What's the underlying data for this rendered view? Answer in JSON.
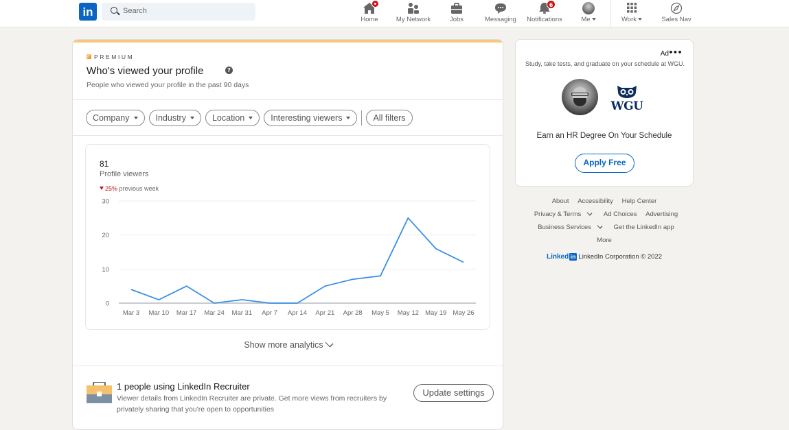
{
  "topbar": {
    "logo": "in",
    "search_placeholder": "Search",
    "nav": [
      {
        "id": "home",
        "label": "Home",
        "icon": "home-icon",
        "badge_dot": true
      },
      {
        "id": "my-network",
        "label": "My Network",
        "icon": "people-icon"
      },
      {
        "id": "jobs",
        "label": "Jobs",
        "icon": "briefcase-icon"
      },
      {
        "id": "messaging",
        "label": "Messaging",
        "icon": "chat-icon"
      },
      {
        "id": "notifications",
        "label": "Notifications",
        "icon": "bell-icon",
        "badge": "6"
      },
      {
        "id": "me",
        "label": "Me",
        "icon": "avatar-icon",
        "dropdown": true
      },
      {
        "id": "work",
        "label": "Work",
        "icon": "grid-icon",
        "dropdown": true
      },
      {
        "id": "sales-nav",
        "label": "Sales Nav",
        "icon": "compass-icon"
      }
    ]
  },
  "main": {
    "premium_label": "PREMIUM",
    "title": "Who's viewed your profile",
    "help_icon": "?",
    "subtitle": "People who viewed your profile in the past 90 days",
    "filters": [
      {
        "label": "Company",
        "dropdown": true
      },
      {
        "label": "Industry",
        "dropdown": true
      },
      {
        "label": "Location",
        "dropdown": true
      },
      {
        "label": "Interesting viewers",
        "dropdown": true
      }
    ],
    "all_filters_label": "All filters",
    "metric": {
      "value": "81",
      "label": "Profile viewers",
      "delta_pct": "25%",
      "delta_direction": "down",
      "delta_suffix": "previous week"
    },
    "show_more_label": "Show more analytics",
    "recruiter": {
      "title": "1 people using LinkedIn Recruiter",
      "description": "Viewer details from LinkedIn Recruiter are private. Get more views from recruiters by privately sharing that you're open to opportunities",
      "button_label": "Update settings"
    }
  },
  "chart_data": {
    "type": "line",
    "title": "",
    "xlabel": "",
    "ylabel": "",
    "categories": [
      "Mar 3",
      "Mar 10",
      "Mar 17",
      "Mar 24",
      "Mar 31",
      "Apr 7",
      "Apr 14",
      "Apr 21",
      "Apr 28",
      "May 5",
      "May 12",
      "May 19",
      "May 26"
    ],
    "series": [
      {
        "name": "Profile viewers",
        "values": [
          4,
          1,
          5,
          0,
          1,
          0,
          0,
          5,
          7,
          8,
          25,
          16,
          12
        ],
        "color": "#3a8ee6"
      }
    ],
    "yticks": [
      0,
      10,
      20,
      30
    ],
    "ylim": [
      0,
      30
    ],
    "grid": true,
    "legend": "none"
  },
  "ad": {
    "label": "Ad",
    "more_label": "•••",
    "text": "Study, take tests, and graduate on your schedule at WGU.",
    "brand": "WGU",
    "headline": "Earn an HR Degree On Your Schedule",
    "button_label": "Apply Free"
  },
  "footer": {
    "rows": [
      [
        {
          "label": "About"
        },
        {
          "label": "Accessibility"
        },
        {
          "label": "Help Center"
        }
      ],
      [
        {
          "label": "Privacy & Terms",
          "dropdown": true
        },
        {
          "label": "Ad Choices"
        },
        {
          "label": "Advertising"
        }
      ],
      [
        {
          "label": "Business Services",
          "dropdown": true
        },
        {
          "label": "Get the LinkedIn app"
        }
      ],
      [
        {
          "label": "More"
        }
      ]
    ],
    "brand_text": "Linked",
    "brand_box": "in",
    "copyright": "LinkedIn Corporation © 2022"
  },
  "colors": {
    "brand": "#0a66c2",
    "premium_accent": "#f8c77e",
    "alert_red": "#cc1016",
    "chart_line": "#3a8ee6"
  }
}
